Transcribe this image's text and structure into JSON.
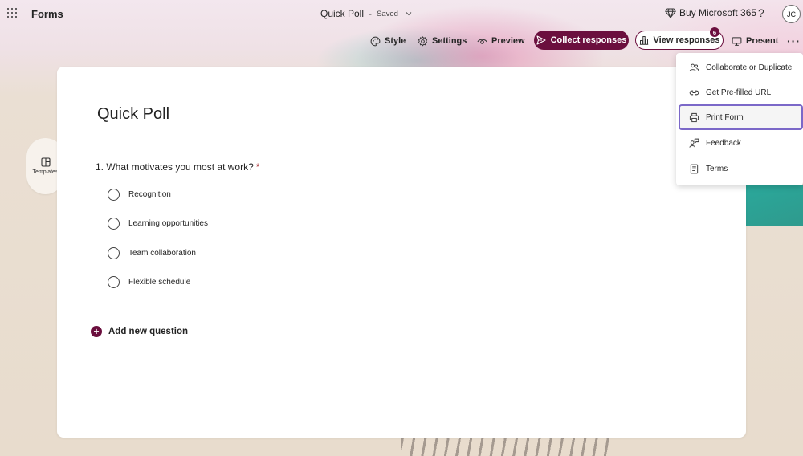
{
  "header": {
    "app_name": "Forms",
    "form_title": "Quick Poll",
    "title_separator": "-",
    "save_status": "Saved",
    "buy_label": "Buy Microsoft 365",
    "help_label": "?",
    "avatar_initials": "JC"
  },
  "toolbar": {
    "style_label": "Style",
    "settings_label": "Settings",
    "preview_label": "Preview",
    "collect_label": "Collect responses",
    "view_responses_label": "View responses",
    "responses_count": "6",
    "present_label": "Present",
    "more_label": "···"
  },
  "sidebar": {
    "templates_label": "Templates"
  },
  "form": {
    "title": "Quick Poll",
    "question": {
      "text": "1. What motivates you most at work?",
      "required_marker": "*",
      "options": [
        {
          "label": "Recognition"
        },
        {
          "label": "Learning opportunities"
        },
        {
          "label": "Team collaboration"
        },
        {
          "label": "Flexible schedule"
        }
      ]
    },
    "add_question_label": "Add new question"
  },
  "menu": {
    "items": [
      {
        "label": "Collaborate or Duplicate",
        "icon": "people-icon"
      },
      {
        "label": "Get Pre-filled URL",
        "icon": "link-icon"
      },
      {
        "label": "Print Form",
        "icon": "printer-icon",
        "focused": true
      },
      {
        "label": "Feedback",
        "icon": "feedback-icon"
      },
      {
        "label": "Terms",
        "icon": "document-icon"
      }
    ]
  },
  "colors": {
    "accent": "#6b0f3e",
    "focus_outline": "#7b68c8",
    "required": "#a4262c"
  }
}
